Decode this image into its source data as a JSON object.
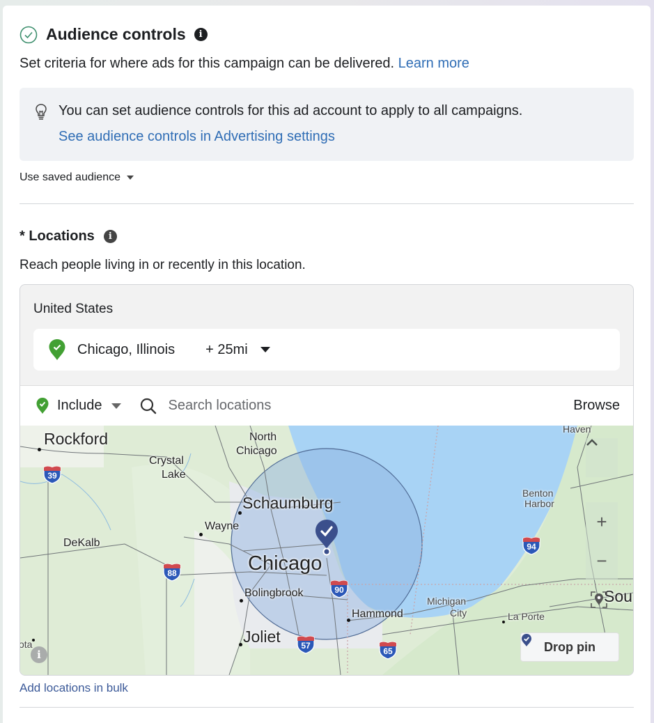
{
  "header": {
    "title": "Audience controls",
    "subtitle": "Set criteria for where ads for this campaign can be delivered.",
    "learn_more": "Learn more"
  },
  "notice": {
    "text": "You can set audience controls for this ad account to apply to all campaigns.",
    "link": "See audience controls in Advertising settings"
  },
  "saved_audience": {
    "label": "Use saved audience"
  },
  "locations": {
    "title": "* Locations",
    "subtitle": "Reach people living in or recently in this location.",
    "country": "United States",
    "selected": {
      "name": "Chicago, Illinois",
      "radius": "+ 25mi"
    },
    "mode": "Include",
    "search_placeholder": "Search locations",
    "search_value": "",
    "browse": "Browse",
    "add_bulk": "Add locations in bulk"
  },
  "map": {
    "cities": {
      "rockford": "Rockford",
      "north_chicago_1": "North",
      "north_chicago_2": "Chicago",
      "crystal_1": "Crystal",
      "crystal_2": "Lake",
      "schaumburg": "Schaumburg",
      "wayne": "Wayne",
      "dekalb": "DeKalb",
      "chicago": "Chicago",
      "bolingbrook": "Bolingbrook",
      "joliet": "Joliet",
      "hammond": "Hammond",
      "michigan_1": "Michigan",
      "michigan_2": "City",
      "la_porte": "La Porte",
      "benton_1": "Benton",
      "benton_2": "Harbor",
      "haven": "Haven",
      "south": "Sou",
      "ota": "ota"
    },
    "interstates": {
      "i39": "39",
      "i88": "88",
      "i90": "90",
      "i57": "57",
      "i65": "65",
      "i94": "94"
    },
    "controls": {
      "up": "^",
      "zoom_in": "+",
      "zoom_out": "−"
    },
    "drop_pin": "Drop pin",
    "info": "i"
  },
  "colors": {
    "link": "#2f6db5",
    "include_green": "#42a033",
    "pin_navy": "#3b4f8c",
    "water": "#a8d3f5",
    "radius_fill": "#8fb2df"
  }
}
